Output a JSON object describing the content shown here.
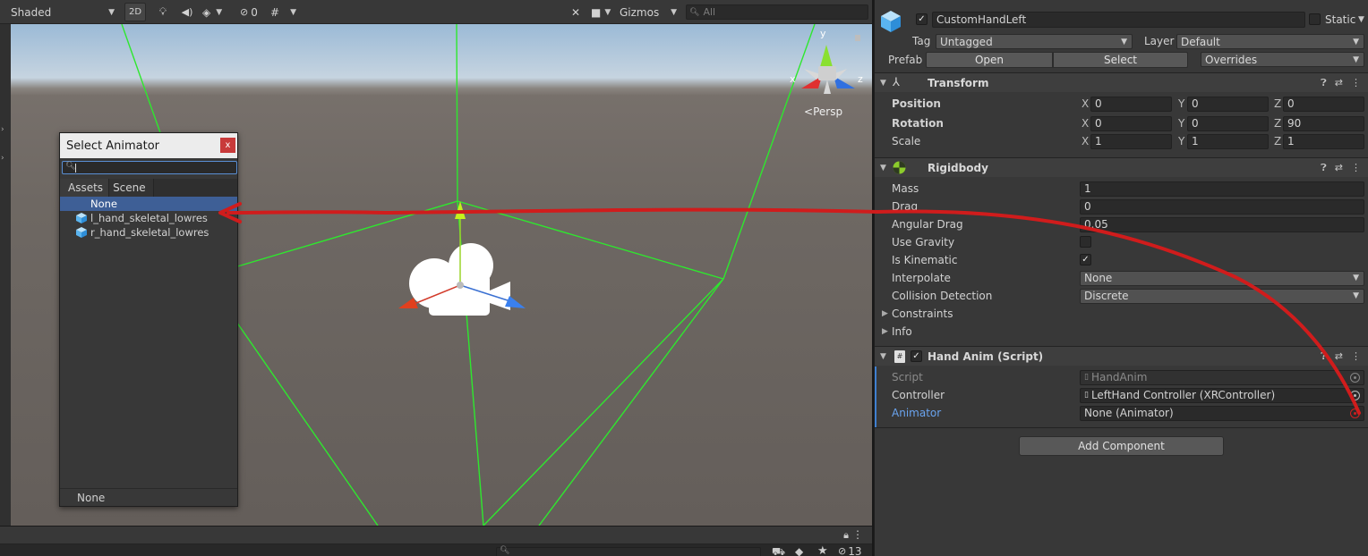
{
  "scene_toolbar": {
    "shading_mode": "Shaded",
    "mode_2d": "2D",
    "hidden_count": "0",
    "gizmos_label": "Gizmos",
    "search_placeholder": "All"
  },
  "scene": {
    "persp_label": "Persp",
    "gizmo_axes": {
      "x": "x",
      "y": "y",
      "z": "z"
    }
  },
  "select_dialog": {
    "title": "Select Animator",
    "close": "x",
    "tabs": [
      "Assets",
      "Scene"
    ],
    "items": [
      {
        "label": "None",
        "selected": true
      },
      {
        "label": "l_hand_skeletal_lowres",
        "selected": false
      },
      {
        "label": "r_hand_skeletal_lowres",
        "selected": false
      }
    ],
    "footer": "None"
  },
  "bottom_bar": {
    "hidden_count": "13"
  },
  "inspector": {
    "object_name": "CustomHandLeft",
    "static_label": "Static",
    "tag_label": "Tag",
    "tag_value": "Untagged",
    "layer_label": "Layer",
    "layer_value": "Default",
    "prefab_label": "Prefab",
    "prefab_open": "Open",
    "prefab_select": "Select",
    "prefab_overrides": "Overrides",
    "transform": {
      "title": "Transform",
      "position_label": "Position",
      "rotation_label": "Rotation",
      "scale_label": "Scale",
      "position": {
        "x": "0",
        "y": "0",
        "z": "0"
      },
      "rotation": {
        "x": "0",
        "y": "0",
        "z": "90"
      },
      "scale": {
        "x": "1",
        "y": "1",
        "z": "1"
      },
      "axis_x": "X",
      "axis_y": "Y",
      "axis_z": "Z"
    },
    "rigidbody": {
      "title": "Rigidbody",
      "mass_label": "Mass",
      "mass": "1",
      "drag_label": "Drag",
      "drag": "0",
      "angular_drag_label": "Angular Drag",
      "angular_drag": "0.05",
      "use_gravity_label": "Use Gravity",
      "use_gravity": false,
      "is_kinematic_label": "Is Kinematic",
      "is_kinematic": true,
      "interpolate_label": "Interpolate",
      "interpolate": "None",
      "collision_label": "Collision Detection",
      "collision": "Discrete",
      "constraints_label": "Constraints",
      "info_label": "Info"
    },
    "hand_anim": {
      "title": "Hand Anim (Script)",
      "script_label": "Script",
      "script": "HandAnim",
      "controller_label": "Controller",
      "controller": "LeftHand Controller (XRController)",
      "animator_label": "Animator",
      "animator": "None (Animator)"
    },
    "add_component": "Add Component"
  },
  "colors": {
    "annotation_red": "#d01c1c",
    "selection_blue": "#3e5f96",
    "link_blue": "#6aa4ef",
    "grid_green": "#2ee82e"
  }
}
